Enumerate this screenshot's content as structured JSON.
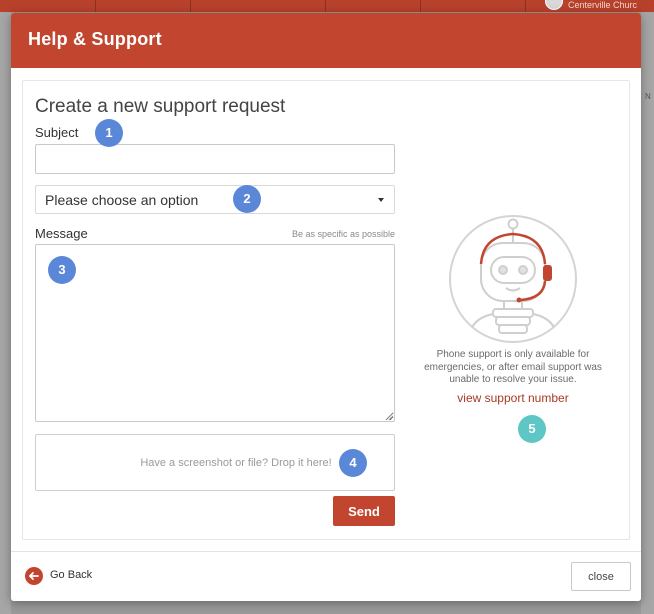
{
  "background": {
    "church_name": "Centerville Churc",
    "right_column_letter": "N"
  },
  "modal": {
    "title": "Help & Support"
  },
  "form": {
    "title": "Create a new support request",
    "subject_label": "Subject",
    "subject_value": "",
    "select_value": "Please choose an option",
    "message_label": "Message",
    "message_hint": "Be as specific as possible",
    "message_value": "",
    "dropzone_text": "Have a screenshot or file? Drop it here!",
    "send_label": "Send"
  },
  "support": {
    "phone_note": "Phone support is only available for emergencies, or after email support was unable to resolve your issue.",
    "link_label": "view support number"
  },
  "badges": [
    "1",
    "2",
    "3",
    "4",
    "5"
  ],
  "footer": {
    "go_back_label": "Go Back",
    "close_label": "close"
  },
  "colors": {
    "brand": "#c2462f",
    "badge_blue": "#5b87d9",
    "badge_teal": "#5ec6c4",
    "link": "#a83a26"
  },
  "icons": {
    "robot": "support-robot-icon",
    "back": "arrow-left-icon",
    "caret": "chevron-down-icon"
  }
}
